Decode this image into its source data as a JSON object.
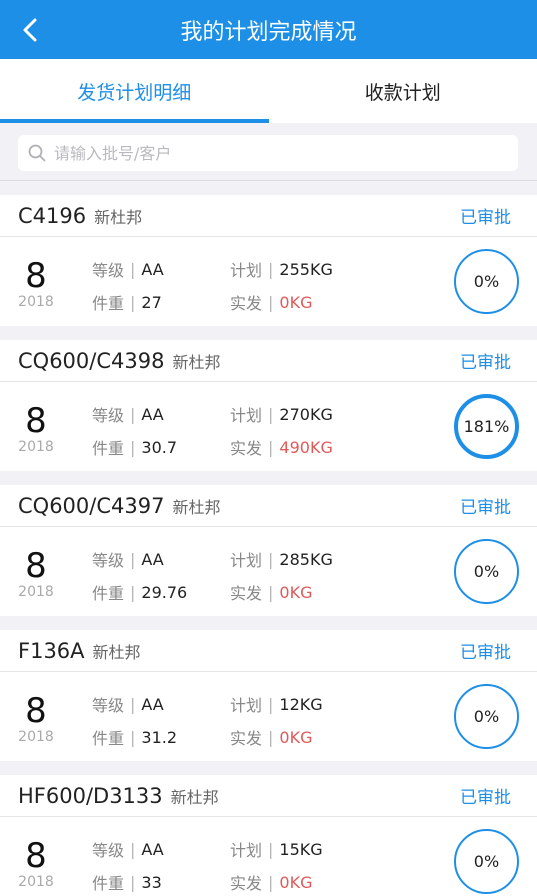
{
  "header": {
    "title": "我的计划完成情况"
  },
  "tabs": [
    {
      "label": "发货计划明细",
      "active": true
    },
    {
      "label": "收款计划",
      "active": false
    }
  ],
  "search": {
    "placeholder": "请输入批号/客户"
  },
  "labels": {
    "grade": "等级",
    "weight": "件重",
    "plan": "计划",
    "actual": "实发"
  },
  "colors": {
    "primary": "#1e8fe6",
    "red": "#e05a5a"
  },
  "cards": [
    {
      "batch": "C4196",
      "customer": "新杜邦",
      "status": "已审批",
      "day": "8",
      "year": "2018",
      "grade": "AA",
      "weight": "27",
      "plan": "255KG",
      "actual": "0KG",
      "percent": "0%"
    },
    {
      "batch": "CQ600/C4398",
      "customer": "新杜邦",
      "status": "已审批",
      "day": "8",
      "year": "2018",
      "grade": "AA",
      "weight": "30.7",
      "plan": "270KG",
      "actual": "490KG",
      "percent": "181%"
    },
    {
      "batch": "CQ600/C4397",
      "customer": "新杜邦",
      "status": "已审批",
      "day": "8",
      "year": "2018",
      "grade": "AA",
      "weight": "29.76",
      "plan": "285KG",
      "actual": "0KG",
      "percent": "0%"
    },
    {
      "batch": "F136A",
      "customer": "新杜邦",
      "status": "已审批",
      "day": "8",
      "year": "2018",
      "grade": "AA",
      "weight": "31.2",
      "plan": "12KG",
      "actual": "0KG",
      "percent": "0%"
    },
    {
      "batch": "HF600/D3133",
      "customer": "新杜邦",
      "status": "已审批",
      "day": "8",
      "year": "2018",
      "grade": "AA",
      "weight": "33",
      "plan": "15KG",
      "actual": "0KG",
      "percent": "0%"
    }
  ]
}
